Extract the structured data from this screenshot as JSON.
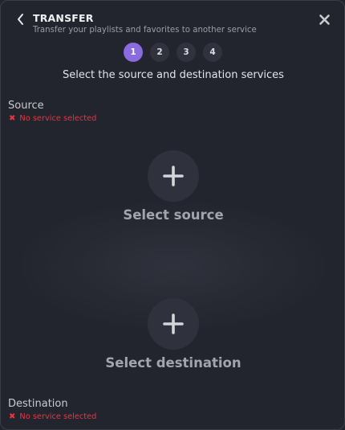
{
  "header": {
    "title": "TRANSFER",
    "subtitle": "Transfer your playlists and favorites to another service"
  },
  "steps": [
    {
      "label": "1",
      "active": true
    },
    {
      "label": "2",
      "active": false
    },
    {
      "label": "3",
      "active": false
    },
    {
      "label": "4",
      "active": false
    }
  ],
  "instruction": "Select the source and destination services",
  "source": {
    "label": "Source",
    "status": "No service selected",
    "select_label": "Select source"
  },
  "destination": {
    "label": "Destination",
    "status": "No service selected",
    "select_label": "Select destination"
  },
  "colors": {
    "accent": "#8a6be0",
    "error": "#e8343f",
    "background": "#23252e"
  },
  "icons": {
    "back": "chevron-left-icon",
    "close": "close-icon",
    "add": "plus-icon",
    "error": "x-mark-icon"
  }
}
